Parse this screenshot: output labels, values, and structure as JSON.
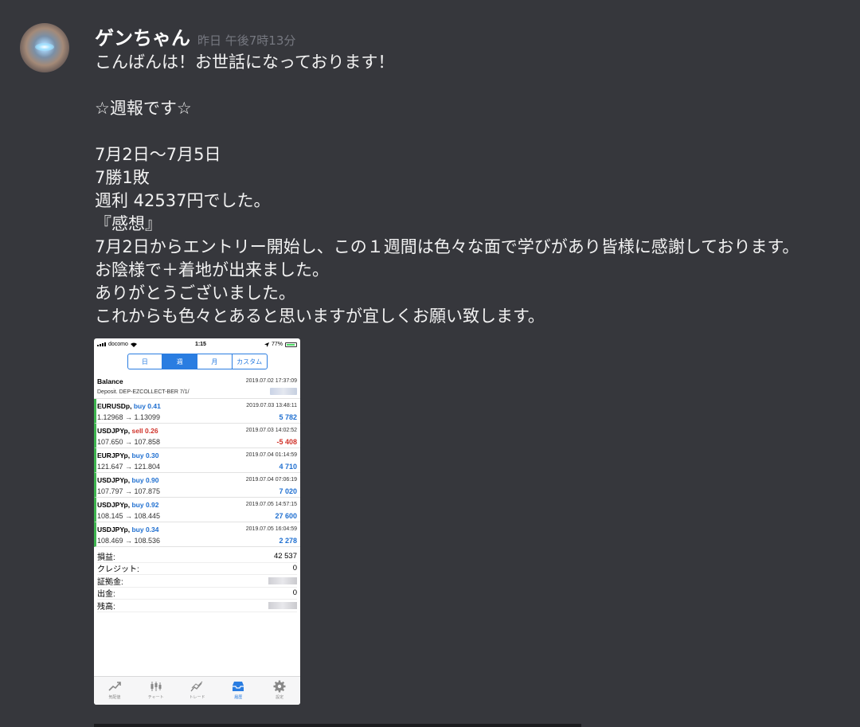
{
  "message": {
    "username": "ゲンちゃん",
    "timestamp": "昨日 午後7時13分",
    "lines": [
      "こんばんは！お世話になっております！",
      "",
      "☆週報です☆",
      "",
      "7月2日〜7月5日",
      "7勝1敗",
      "週利  42537円でした。",
      "『感想』",
      "7月2日からエントリー開始し、この１週間は色々な面で学びがあり皆様に感謝しております。",
      "お陰様で＋着地が出来ました。",
      "ありがとうございました。",
      "これからも色々とあると思いますが宜しくお願い致します。"
    ]
  },
  "phone": {
    "status": {
      "carrier": "docomo",
      "time": "1:15",
      "battery": "77%"
    },
    "segments": [
      {
        "label": "日",
        "active": false
      },
      {
        "label": "週",
        "active": true
      },
      {
        "label": "月",
        "active": false
      },
      {
        "label": "カスタム",
        "active": false
      }
    ],
    "balance": {
      "title": "Balance",
      "datetime": "2019.07.02 17:37:09",
      "desc": "Deposit. DEP-EZCOLLECT-BER 7/1/"
    },
    "trades": [
      {
        "symbol": "EURUSDp,",
        "side": "buy",
        "volume": "buy 0.41",
        "prices": "1.12968 → 1.13099",
        "datetime": "2019.07.03 13:48:11",
        "profit": "5 782"
      },
      {
        "symbol": "USDJPYp,",
        "side": "sell",
        "volume": "sell 0.26",
        "prices": "107.650 → 107.858",
        "datetime": "2019.07.03 14:02:52",
        "profit": "-5 408"
      },
      {
        "symbol": "EURJPYp,",
        "side": "buy",
        "volume": "buy 0.30",
        "prices": "121.647 → 121.804",
        "datetime": "2019.07.04 01:14:59",
        "profit": "4 710"
      },
      {
        "symbol": "USDJPYp,",
        "side": "buy",
        "volume": "buy 0.90",
        "prices": "107.797 → 107.875",
        "datetime": "2019.07.04 07:06:19",
        "profit": "7 020"
      },
      {
        "symbol": "USDJPYp,",
        "side": "buy",
        "volume": "buy 0.92",
        "prices": "108.145 → 108.445",
        "datetime": "2019.07.05 14:57:15",
        "profit": "27 600"
      },
      {
        "symbol": "USDJPYp,",
        "side": "buy",
        "volume": "buy 0.34",
        "prices": "108.469 → 108.536",
        "datetime": "2019.07.05 16:04:59",
        "profit": "2 278"
      }
    ],
    "summary": [
      {
        "label": "損益:",
        "value": "42 537"
      },
      {
        "label": "クレジット:",
        "value": "0"
      },
      {
        "label": "証拠金:",
        "value": null
      },
      {
        "label": "出金:",
        "value": "0"
      },
      {
        "label": "残高:",
        "value": null
      }
    ],
    "tabs": [
      {
        "label": "気配値",
        "icon": "quotes-icon",
        "active": false
      },
      {
        "label": "チャート",
        "icon": "chart-candles-icon",
        "active": false
      },
      {
        "label": "トレード",
        "icon": "trade-icon",
        "active": false
      },
      {
        "label": "履歴",
        "icon": "history-inbox-icon",
        "active": true
      },
      {
        "label": "設定",
        "icon": "settings-gear-icon",
        "active": false
      }
    ],
    "colors": {
      "accent": "#2a7de1",
      "profit": "#1f6fd0",
      "loss": "#d0332a",
      "edge": "#3eb34f"
    }
  }
}
